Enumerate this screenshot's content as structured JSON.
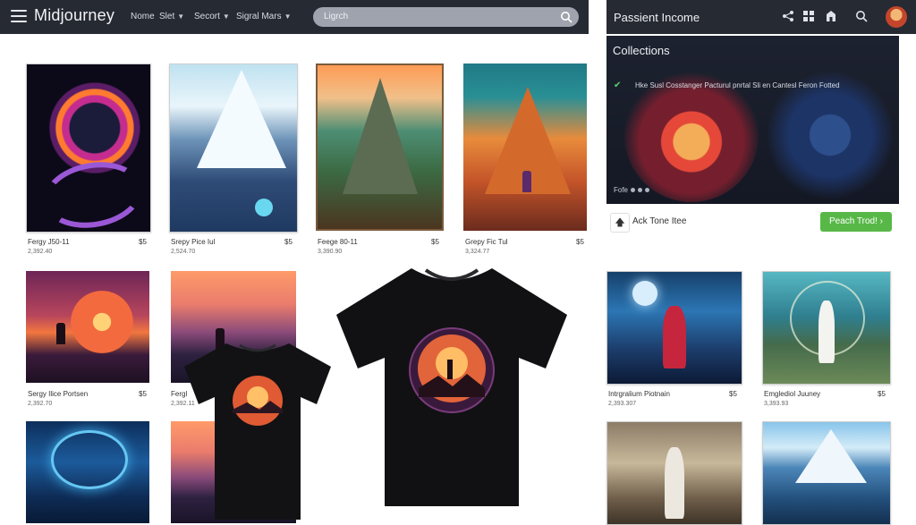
{
  "app": {
    "brand": "Midjourney"
  },
  "nav": [
    {
      "label": "Nome",
      "has_caret": false
    },
    {
      "label": "Slet",
      "has_caret": true
    },
    {
      "label": "Secort",
      "has_caret": true
    },
    {
      "label": "Sigral Mars",
      "has_caret": true
    }
  ],
  "search": {
    "placeholder": "Ligrch"
  },
  "right_header": {
    "title": "Passient Income"
  },
  "collections": {
    "title": "Collections",
    "line": "Hke Susl Cosstanger Pacturul pnrtal Sli en Cantesl Feron Fotted",
    "pager_label": "Fofe"
  },
  "side_action": {
    "label": "Ack Tone Itee"
  },
  "cta": {
    "label": "Peach Trod!"
  },
  "products": [
    {
      "title": "Fergy J50-11",
      "sub": "2,392.40",
      "price": "$5"
    },
    {
      "title": "Srepy Pice Iul",
      "sub": "2,524.70",
      "price": "$5"
    },
    {
      "title": "Feege 80-11",
      "sub": "3,390.90",
      "price": "$5"
    },
    {
      "title": "Grepy Fic Tul",
      "sub": "3,324.77",
      "price": "$5"
    },
    {
      "title": "Sergy Ilice Portsen",
      "sub": "2,392.70",
      "price": "$5"
    },
    {
      "title": "Fergl",
      "sub": "2,392.11",
      "price": ""
    },
    {
      "title": "Intrgralium Piotnain",
      "sub": "2,393.307",
      "price": "$5"
    },
    {
      "title": "Emglediol Juuney",
      "sub": "3,393.93",
      "price": "$5"
    }
  ],
  "colors": {
    "topbar": "#262a33",
    "cta_green": "#57b847",
    "check_green": "#59d36a"
  }
}
